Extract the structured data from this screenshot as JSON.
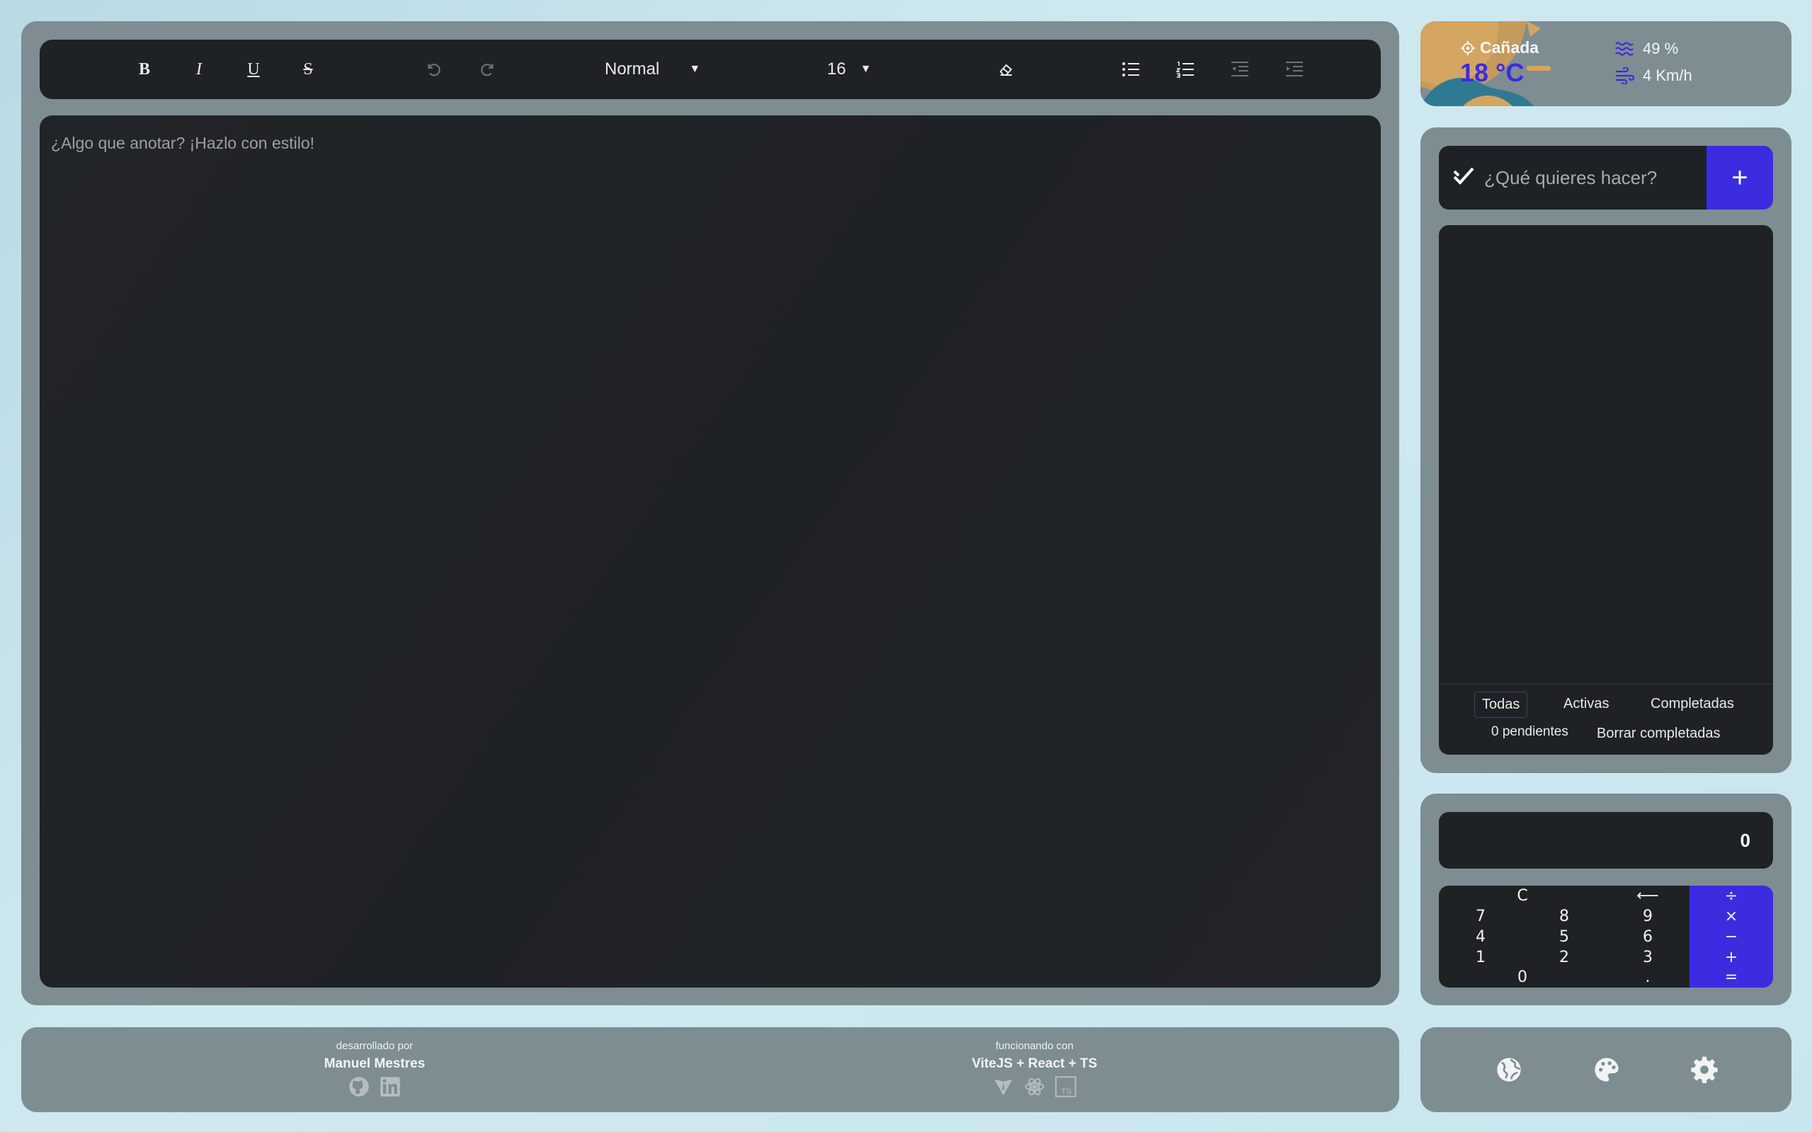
{
  "editor": {
    "toolbar": {
      "bold_label": "B",
      "italic_label": "I",
      "underline_label": "U",
      "strike_label": "S",
      "block_style": "Normal",
      "font_size": "16"
    },
    "placeholder": "¿Algo que anotar? ¡Hazlo con estilo!"
  },
  "footer": {
    "author_caption": "desarrollado por",
    "author_name": "Manuel Mestres",
    "tech_caption": "funcionando con",
    "tech_stack": "ViteJS + React + TS",
    "author_icons": [
      "github-icon",
      "linkedin-icon"
    ],
    "tech_icons": [
      "vite-icon",
      "react-icon",
      "typescript-icon"
    ]
  },
  "weather": {
    "city": "Cañada",
    "temperature": "18 °C",
    "humidity": "49 %",
    "wind": "4 Km/h"
  },
  "todo": {
    "placeholder": "¿Qué quieres hacer?",
    "add_label": "+",
    "filters": [
      "Todas",
      "Activas",
      "Completadas"
    ],
    "active_filter": "Todas",
    "pending": "0 pendientes",
    "clear_completed": "Borrar completadas"
  },
  "calculator": {
    "display": "0",
    "keys": {
      "clear": "C",
      "back": "⟵",
      "divide": "÷",
      "multiply": "×",
      "minus": "−",
      "plus": "+",
      "equals": "=",
      "k7": "7",
      "k8": "8",
      "k9": "9",
      "k4": "4",
      "k5": "5",
      "k6": "6",
      "k1": "1",
      "k2": "2",
      "k3": "3",
      "k0": "0",
      "dot": "."
    }
  },
  "settings": {
    "icons": [
      "globe-icon",
      "palette-icon",
      "gear-icon"
    ]
  },
  "colors": {
    "accent": "#3b2ce0",
    "panel": "#7d8d92",
    "surface": "#1f2225"
  }
}
